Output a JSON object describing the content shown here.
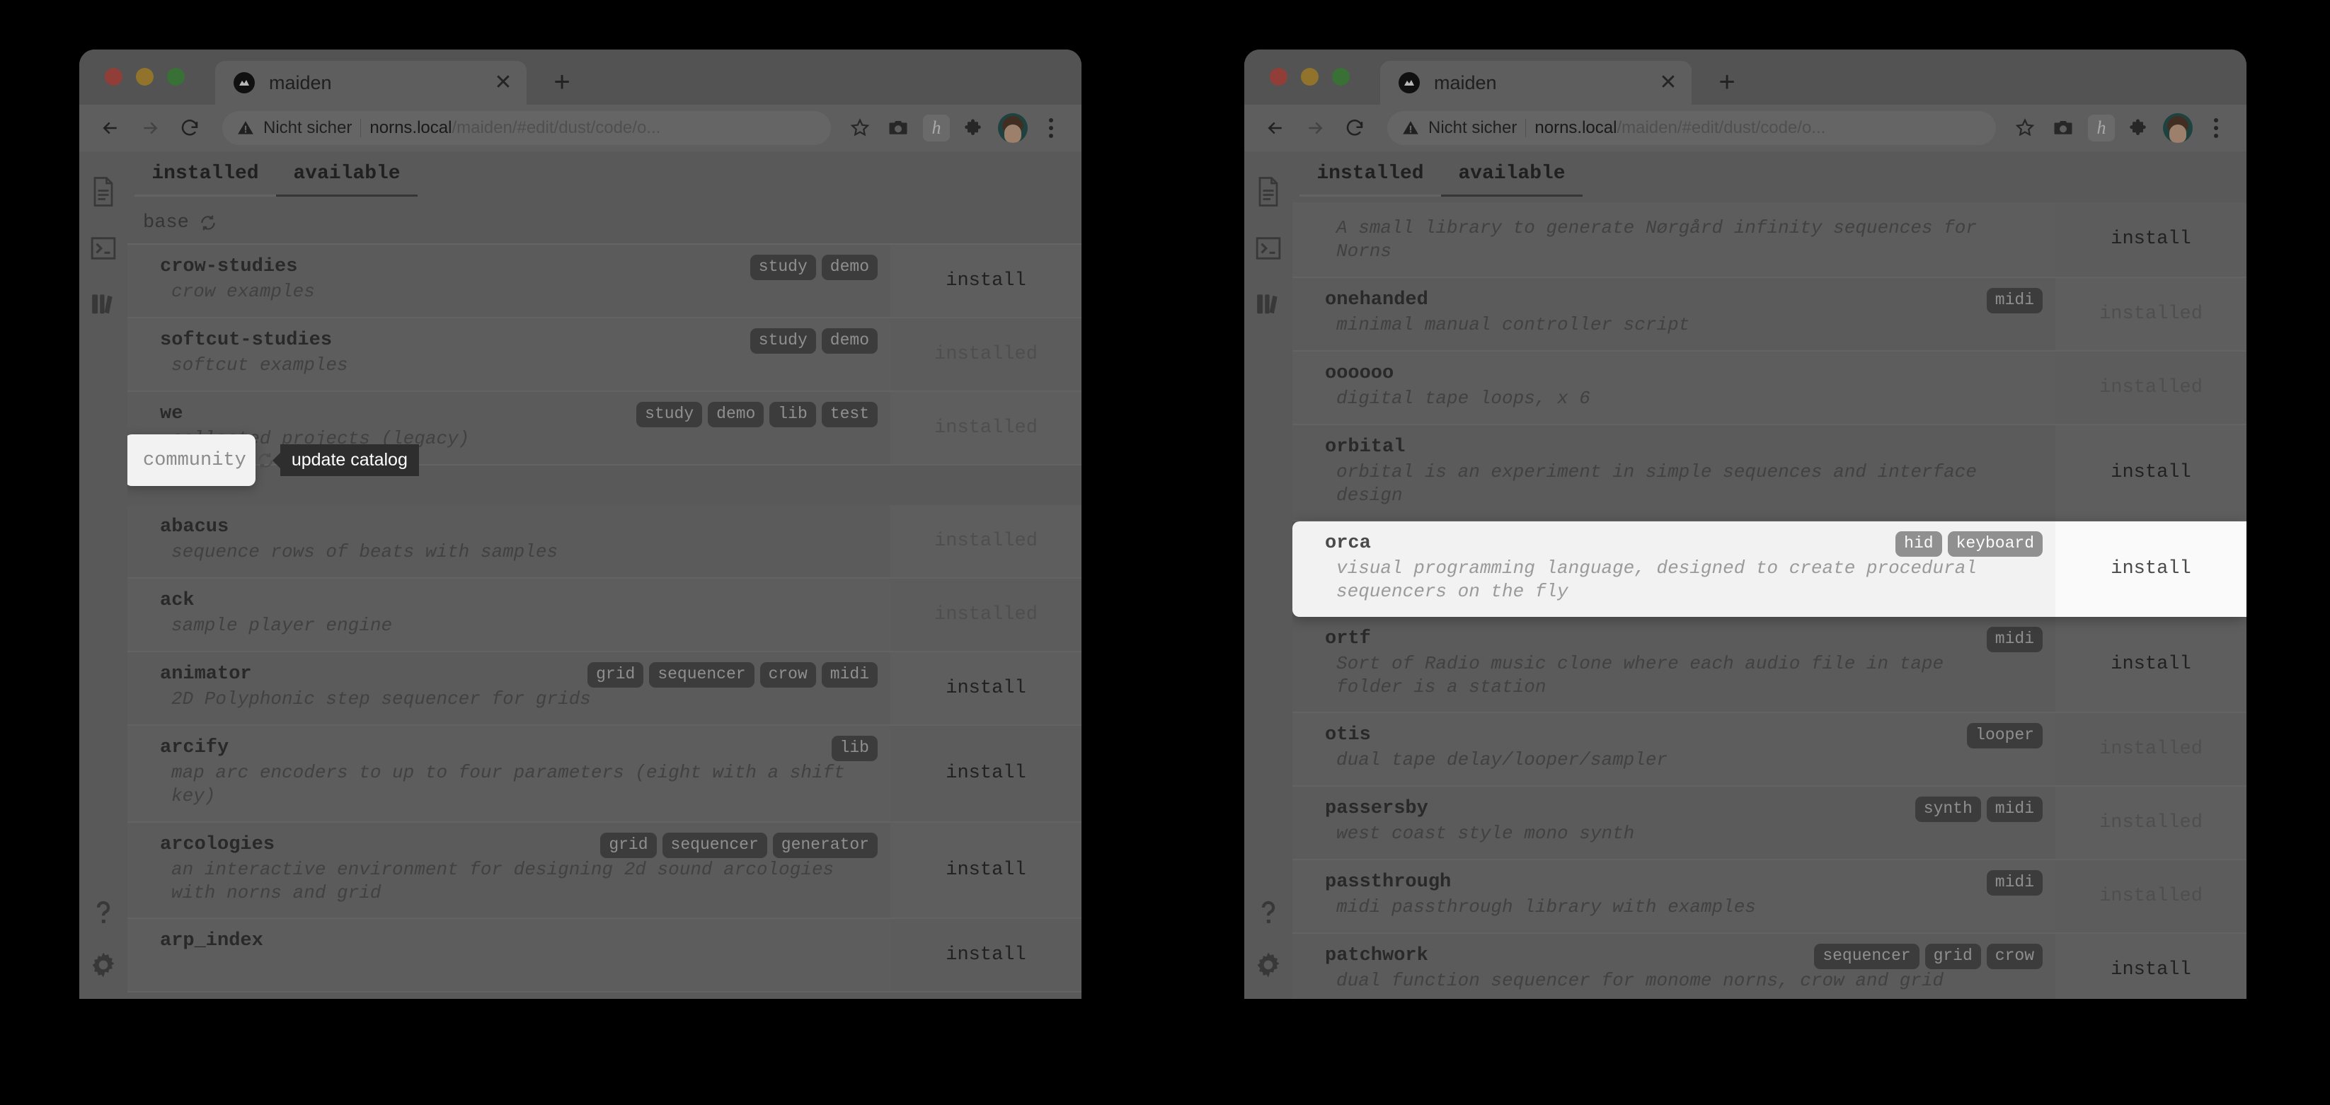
{
  "browser": {
    "tab_title": "maiden",
    "tab_close_label": "✕",
    "new_tab_label": "+",
    "security_label": "Nicht sicher",
    "url_host": "norns.local",
    "url_path": "/maiden/#edit/dust/code/o...",
    "icons": {
      "back": "back-arrow-icon",
      "forward": "forward-arrow-icon",
      "reload": "reload-icon",
      "warning": "warning-triangle-icon",
      "bookmark": "star-icon",
      "screenshot": "camera-icon",
      "honey_extension": "h",
      "extensions": "puzzle-piece-icon",
      "profile": "avatar-icon",
      "menu": "kebab-menu-icon"
    }
  },
  "sidebar": {
    "items": [
      {
        "name": "script-editor",
        "icon": "document-icon"
      },
      {
        "name": "repl-terminal",
        "icon": "terminal-icon"
      },
      {
        "name": "library-catalog",
        "icon": "books-icon"
      }
    ],
    "bottom_items": [
      {
        "name": "help",
        "icon": "question-mark-icon"
      },
      {
        "name": "settings",
        "icon": "gear-icon"
      }
    ]
  },
  "tabs": {
    "installed_label": "installed",
    "available_label": "available",
    "active": "available"
  },
  "left_window": {
    "section": {
      "label": "base",
      "refresh_icon": "refresh-icon"
    },
    "tooltip": "update catalog",
    "community_section": {
      "label": "community",
      "refresh_icon": "refresh-icon"
    },
    "base_rows": [
      {
        "name": "crow-studies",
        "desc": "crow examples",
        "tags": [
          "study",
          "demo"
        ],
        "action": "install",
        "action_state": "install"
      },
      {
        "name": "softcut-studies",
        "desc": "softcut examples",
        "tags": [
          "study",
          "demo"
        ],
        "action": "installed",
        "action_state": "installed"
      },
      {
        "name": "we",
        "desc": "collected projects (legacy)",
        "tags": [
          "study",
          "demo",
          "lib",
          "test"
        ],
        "action": "installed",
        "action_state": "installed"
      }
    ],
    "community_rows": [
      {
        "name": "abacus",
        "desc": "sequence rows of beats with samples",
        "tags": [],
        "action": "installed",
        "action_state": "installed"
      },
      {
        "name": "ack",
        "desc": "sample player engine",
        "tags": [],
        "action": "installed",
        "action_state": "installed"
      },
      {
        "name": "animator",
        "desc": "2D Polyphonic step sequencer for grids",
        "tags": [
          "grid",
          "sequencer",
          "crow",
          "midi"
        ],
        "action": "install",
        "action_state": "install"
      },
      {
        "name": "arcify",
        "desc": "map arc encoders to up to four parameters (eight with a shift key)",
        "tags": [
          "lib"
        ],
        "action": "install",
        "action_state": "install"
      },
      {
        "name": "arcologies",
        "desc": "an interactive environment for designing 2d sound arcologies with norns and grid",
        "tags": [
          "grid",
          "sequencer",
          "generator"
        ],
        "action": "install",
        "action_state": "install"
      },
      {
        "name": "arp_index",
        "desc": "",
        "tags": [],
        "action": "install",
        "action_state": "install"
      }
    ]
  },
  "right_window": {
    "rows": [
      {
        "name": "",
        "desc": "A small library to generate Nørgård infinity sequences for Norns",
        "tags": [],
        "action": "install",
        "action_state": "install"
      },
      {
        "name": "onehanded",
        "desc": "minimal manual controller script",
        "tags": [
          "midi"
        ],
        "action": "installed",
        "action_state": "installed"
      },
      {
        "name": "oooooo",
        "desc": "digital tape loops, x 6",
        "tags": [],
        "action": "installed",
        "action_state": "installed"
      },
      {
        "name": "orbital",
        "desc": "orbital is an experiment in simple sequences and interface design",
        "tags": [],
        "action": "install",
        "action_state": "install"
      },
      {
        "name": "orca",
        "desc": "visual programming language, designed to create procedural sequencers on the fly",
        "tags": [
          "hid",
          "keyboard"
        ],
        "action": "install",
        "action_state": "install",
        "highlighted": true
      },
      {
        "name": "ortf",
        "desc": "Sort of Radio music clone where each audio file in tape folder is a station",
        "tags": [
          "midi"
        ],
        "action": "install",
        "action_state": "install"
      },
      {
        "name": "otis",
        "desc": "dual tape delay/looper/sampler",
        "tags": [
          "looper"
        ],
        "action": "installed",
        "action_state": "installed"
      },
      {
        "name": "passersby",
        "desc": "west coast style mono synth",
        "tags": [
          "synth",
          "midi"
        ],
        "action": "installed",
        "action_state": "installed"
      },
      {
        "name": "passthrough",
        "desc": "midi passthrough library with examples",
        "tags": [
          "midi"
        ],
        "action": "installed",
        "action_state": "installed"
      },
      {
        "name": "patchwork",
        "desc": "dual function sequencer for monome norns, crow and grid",
        "tags": [
          "sequencer",
          "grid",
          "crow"
        ],
        "action": "install",
        "action_state": "install"
      }
    ]
  },
  "colors": {
    "window_bg": "#7c7c7c",
    "chrome_bg": "#838383",
    "tag_bg": "#545454",
    "tooltip_bg": "#2e2e2e",
    "highlight_bg": "#f2f2f2",
    "traffic_red": "#c9564f",
    "traffic_yellow": "#c9a03c",
    "traffic_green": "#4e9c4a"
  }
}
